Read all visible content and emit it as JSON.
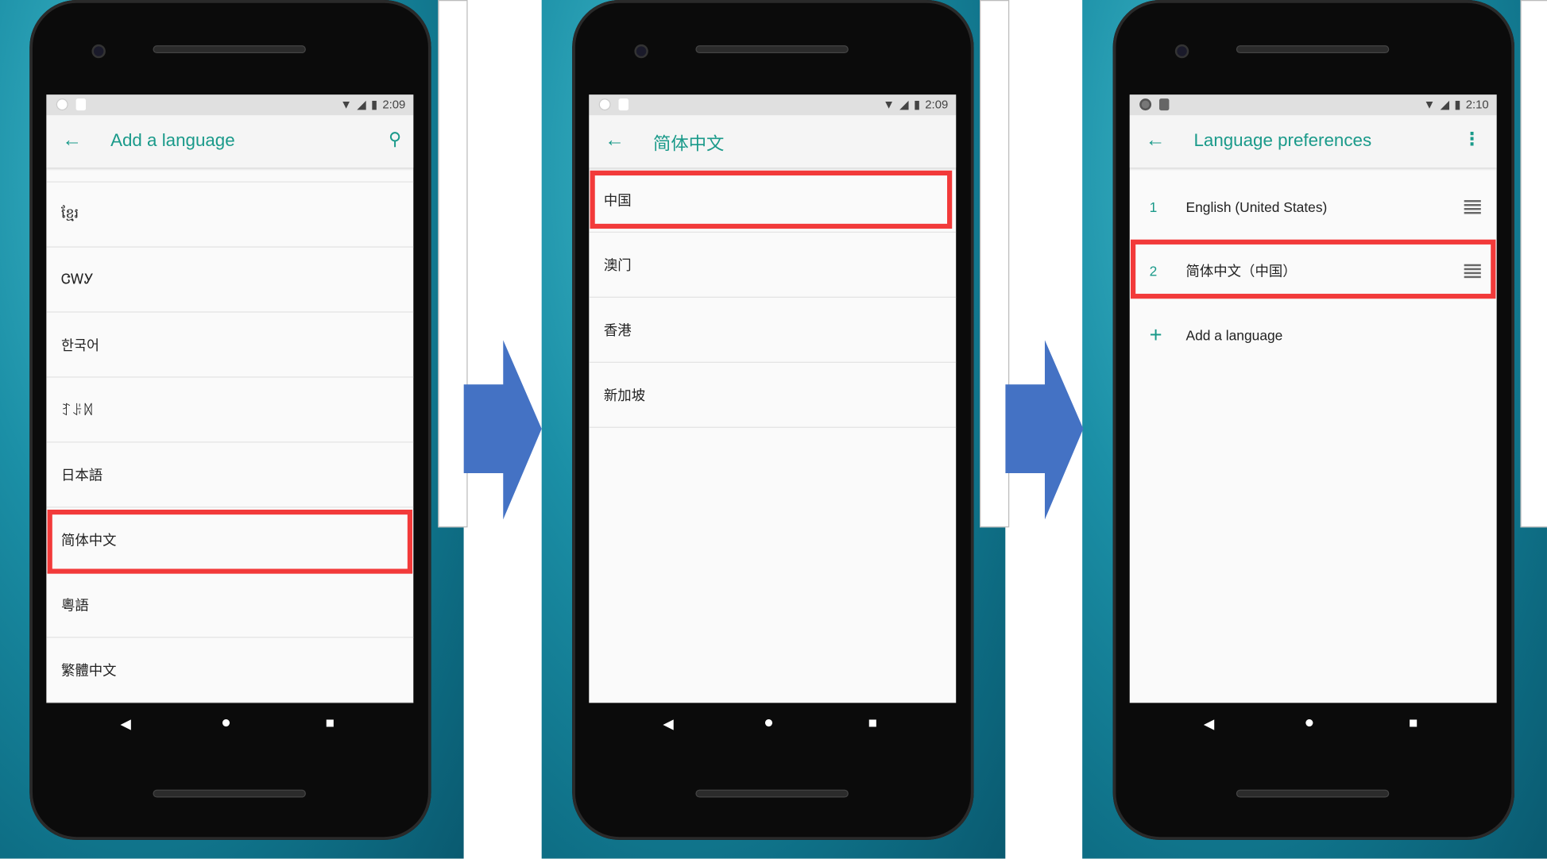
{
  "colors": {
    "accent": "#1a9a8a",
    "highlight": "#f23a3a",
    "arrow": "#4472c4"
  },
  "phones": [
    {
      "time": "2:09",
      "title": "Add a language",
      "action_icon": "search-icon",
      "items": [
        "ខ្មែរ",
        "ᏣᎳᎩ",
        "한국어",
        "ꆈꌠꉙ",
        "日本語",
        "简体中文",
        "粵語",
        "繁體中文"
      ],
      "highlighted": "简体中文"
    },
    {
      "time": "2:09",
      "title": "简体中文",
      "items": [
        "中国",
        "澳门",
        "香港",
        "新加坡"
      ],
      "highlighted": "中国"
    },
    {
      "time": "2:10",
      "title": "Language preferences",
      "action_icon": "more-vert-icon",
      "items": [
        {
          "num": "1",
          "label": "English (United States)"
        },
        {
          "num": "2",
          "label": "简体中文（中国）"
        }
      ],
      "add_label": "Add a language",
      "highlighted": "简体中文（中国）"
    }
  ]
}
